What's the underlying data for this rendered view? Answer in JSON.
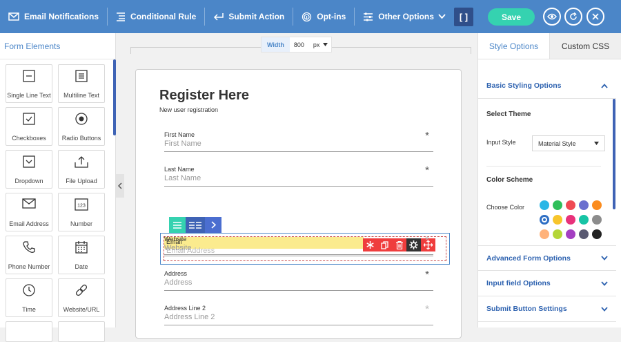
{
  "toolbar": {
    "items": [
      {
        "label": "Email Notifications",
        "icon": "mail-icon"
      },
      {
        "label": "Conditional Rule",
        "icon": "rule-icon"
      },
      {
        "label": "Submit Action",
        "icon": "submit-arrow-icon"
      },
      {
        "label": "Opt-ins",
        "icon": "fingerprint-icon"
      },
      {
        "label": "Other Options",
        "icon": "sliders-icon"
      }
    ],
    "bracket_label": "[ ]",
    "save_label": "Save"
  },
  "left_panel": {
    "title": "Form Elements",
    "elements": [
      {
        "label": "Single Line Text",
        "icon": "single-line-icon"
      },
      {
        "label": "Multiline Text",
        "icon": "multiline-icon"
      },
      {
        "label": "Checkboxes",
        "icon": "checkbox-icon"
      },
      {
        "label": "Radio Buttons",
        "icon": "radio-icon"
      },
      {
        "label": "Dropdown",
        "icon": "dropdown-icon"
      },
      {
        "label": "File Upload",
        "icon": "upload-icon"
      },
      {
        "label": "Email Address",
        "icon": "mail-icon"
      },
      {
        "label": "Number",
        "icon": "number-icon"
      },
      {
        "label": "Phone Number",
        "icon": "phone-icon"
      },
      {
        "label": "Date",
        "icon": "calendar-icon"
      },
      {
        "label": "Time",
        "icon": "clock-icon"
      },
      {
        "label": "Website/URL",
        "icon": "link-icon"
      }
    ]
  },
  "canvas": {
    "width_label": "Width",
    "width_value": "800",
    "width_unit": "px",
    "form_title": "Register Here",
    "form_subtitle": "New user registration",
    "fields": [
      {
        "label": "First Name",
        "placeholder": "First Name",
        "required": true
      },
      {
        "label": "Last Name",
        "placeholder": "Last Name",
        "required": true
      },
      {
        "label": "Website",
        "placeholder": "Website",
        "required": false
      },
      {
        "label": "Address",
        "placeholder": "Address",
        "required": true
      },
      {
        "label": "Address Line 2",
        "placeholder": "Address Line 2",
        "required": false
      }
    ],
    "selected_field": {
      "label": "Email",
      "placeholder": "Email Address"
    },
    "asterisk": "*"
  },
  "right_panel": {
    "tabs": [
      "Style Options",
      "Custom CSS"
    ],
    "basic_styling": "Basic Styling Options",
    "select_theme": "Select Theme",
    "input_style_label": "Input Style",
    "input_style_value": "Material Style",
    "color_scheme": "Color Scheme",
    "choose_color": "Choose Color",
    "colors": [
      "#29b6e6",
      "#2fbf5a",
      "#ef4a54",
      "#6a6fcf",
      "#fb8c1e",
      "#2f6fc4",
      "#f7c52b",
      "#e8327b",
      "#17c4a5",
      "#8c8c8c",
      "#ffb27a",
      "#b4d638",
      "#a43fc2",
      "#5a5a72",
      "#222222"
    ],
    "selected_color_index": 5,
    "sections": [
      "Advanced Form Options",
      "Input field Options",
      "Submit Button Settings"
    ]
  }
}
